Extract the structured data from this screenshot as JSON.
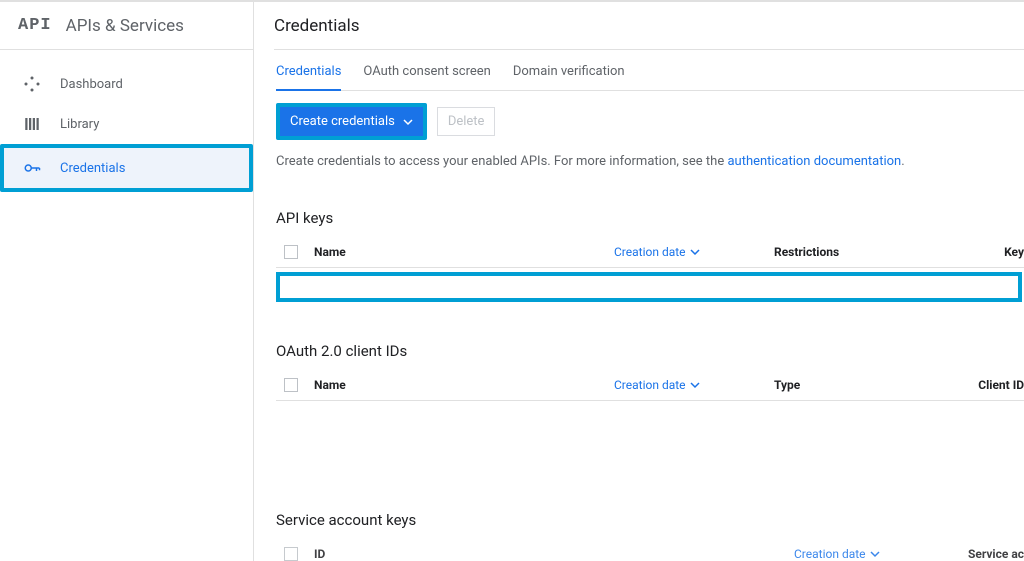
{
  "product": {
    "logo": "API",
    "title": "APIs & Services"
  },
  "sidebar": {
    "items": [
      {
        "label": "Dashboard"
      },
      {
        "label": "Library"
      },
      {
        "label": "Credentials"
      }
    ]
  },
  "page": {
    "title": "Credentials"
  },
  "tabs": [
    {
      "label": "Credentials"
    },
    {
      "label": "OAuth consent screen"
    },
    {
      "label": "Domain verification"
    }
  ],
  "buttons": {
    "create": "Create credentials",
    "delete": "Delete"
  },
  "info": {
    "text": "Create credentials to access your enabled APIs. For more information, see the ",
    "link": "authentication documentation",
    "period": "."
  },
  "sections": {
    "apikeys": {
      "title": "API keys",
      "cols": {
        "name": "Name",
        "cdate": "Creation date",
        "restrictions": "Restrictions",
        "key": "Key"
      }
    },
    "oauth": {
      "title": "OAuth 2.0 client IDs",
      "cols": {
        "name": "Name",
        "cdate": "Creation date",
        "type": "Type",
        "clientid": "Client ID"
      }
    },
    "svc": {
      "title": "Service account keys",
      "cols": {
        "id": "ID",
        "cdate": "Creation date",
        "svcacc": "Service ac"
      }
    }
  }
}
